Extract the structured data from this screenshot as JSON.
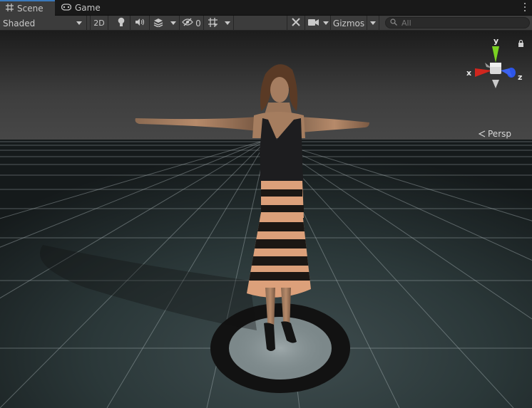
{
  "tabs": [
    {
      "label": "Scene",
      "icon": "grid-icon",
      "active": true
    },
    {
      "label": "Game",
      "icon": "gamepad-icon",
      "active": false
    }
  ],
  "toolbar": {
    "draw_mode": "Shaded",
    "toggle_2d": "2D",
    "hidden_count": "0",
    "gizmos": "Gizmos",
    "search_placeholder": "All"
  },
  "orientation_gizmo": {
    "axis_y": "y",
    "axis_x": "x",
    "axis_z": "z",
    "projection": "Persp",
    "colors": {
      "x": "#d0261e",
      "y": "#7ad221",
      "z": "#2c55e8"
    }
  },
  "theme": {
    "tab_active_accent": "#3a79bb",
    "toolbar_bg": "#3c3c3c",
    "floor_color": "#2f3c3d",
    "dress_stripe_light": "#e0a27a",
    "dress_stripe_dark": "#1b1714"
  }
}
